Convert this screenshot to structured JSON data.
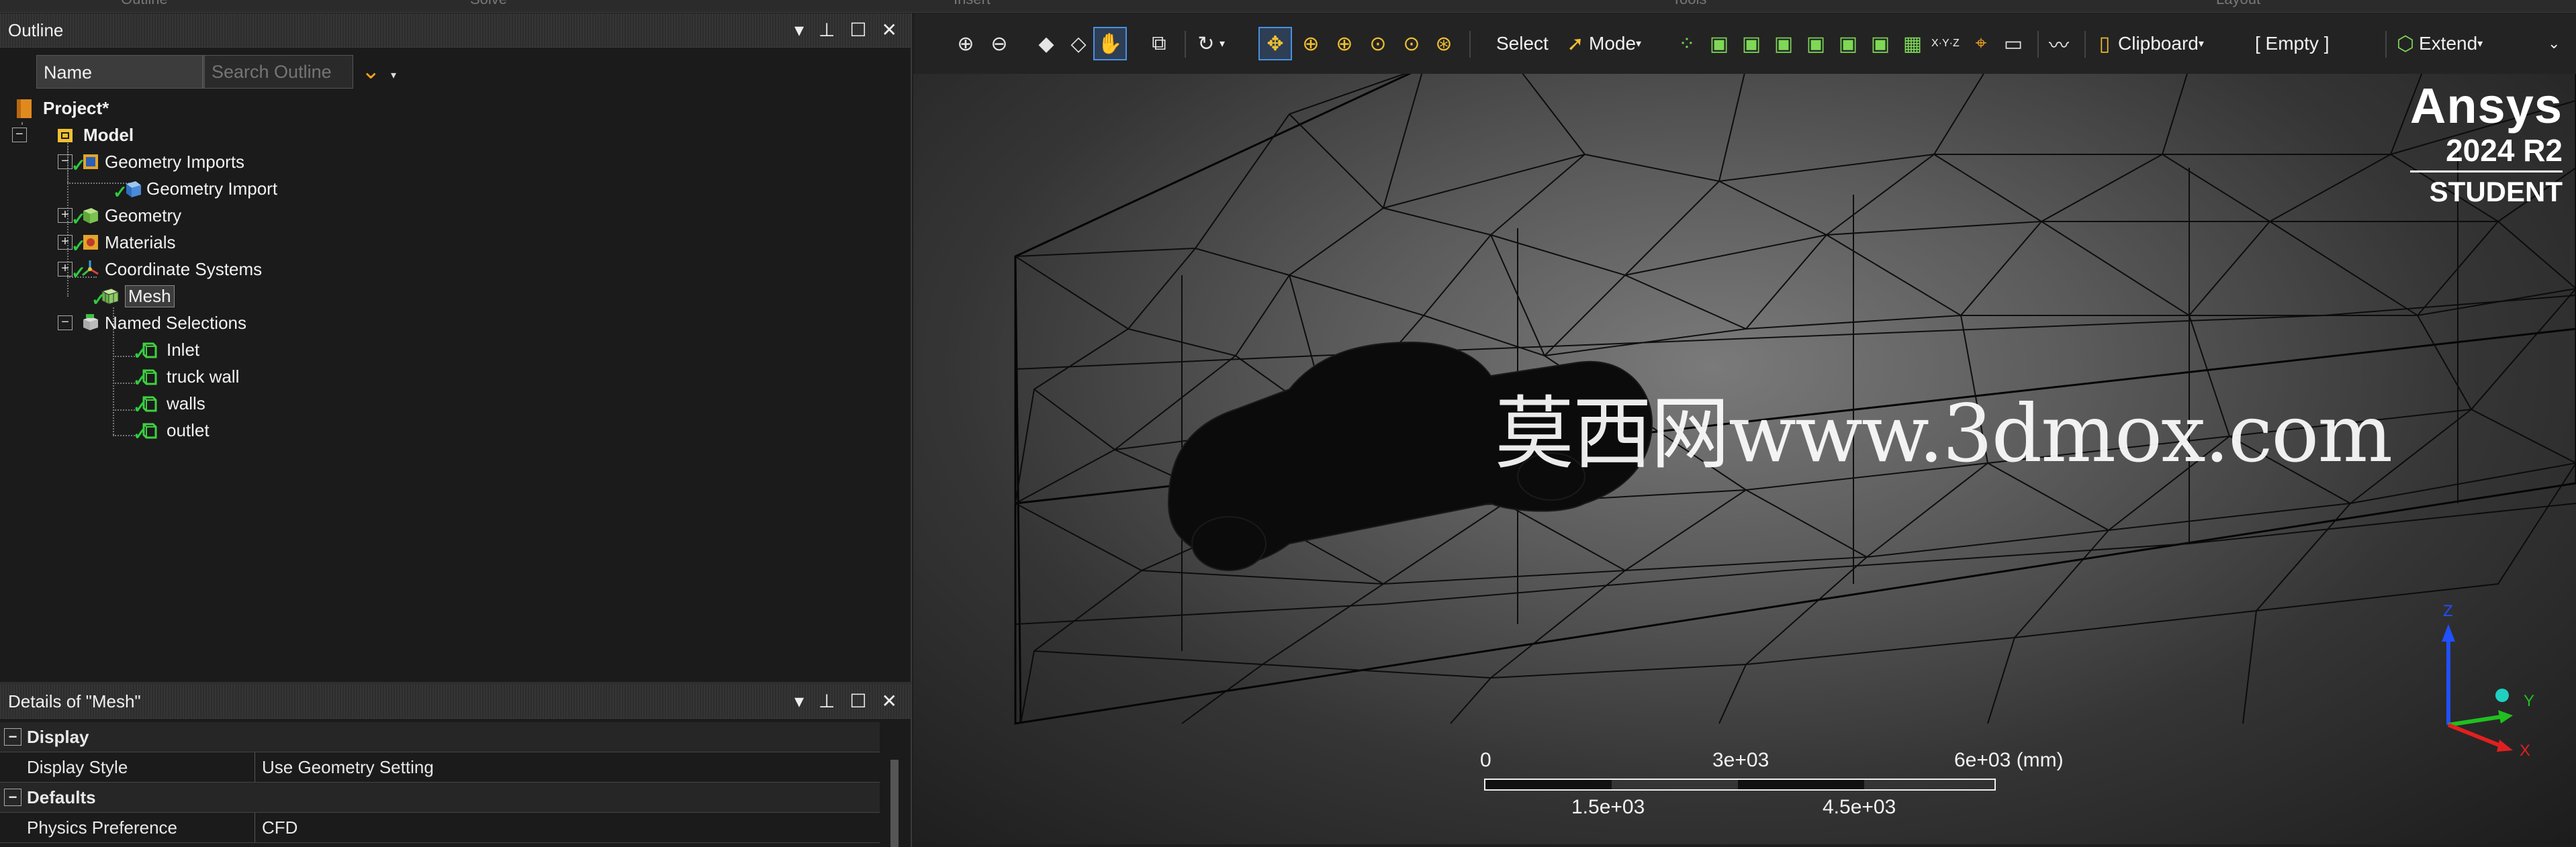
{
  "ribbon_top_tabs": [
    "Outline",
    "Solve",
    "Insert",
    "Tools",
    "Layout"
  ],
  "outline": {
    "title": "Outline",
    "controls": {
      "pin": "▾",
      "dock": "𝗣",
      "max": "☐",
      "close": "✕"
    },
    "filter": {
      "selected": "Name",
      "search_placeholder": "Search Outline"
    },
    "tree": {
      "project": "Project*",
      "model": "Model",
      "geometry_imports": "Geometry Imports",
      "geometry_import": "Geometry Import",
      "geometry": "Geometry",
      "materials": "Materials",
      "coordinate_systems": "Coordinate Systems",
      "mesh": "Mesh",
      "named_selections": "Named Selections",
      "ns_items": [
        "Inlet",
        "truck wall",
        "walls",
        "outlet"
      ]
    }
  },
  "details": {
    "title": "Details of \"Mesh\"",
    "rows": [
      {
        "type": "category",
        "label": "Display"
      },
      {
        "type": "prop",
        "key": "Display Style",
        "value": "Use Geometry Setting"
      },
      {
        "type": "category",
        "label": "Defaults"
      },
      {
        "type": "prop",
        "key": "Physics Preference",
        "value": "CFD"
      }
    ]
  },
  "toolbar": {
    "select_label": "Select",
    "mode_label": "Mode",
    "clipboard_label": "Clipboard",
    "empty_label": "[ Empty ]",
    "extend_label": "Extend",
    "xyz_label": "X·Y·Z"
  },
  "brand": {
    "name": "Ansys",
    "version": "2024 R2",
    "edition": "STUDENT"
  },
  "watermark": "莫西网www.3dmox.com",
  "scale_bar": {
    "top_labels": [
      "0",
      "3e+03",
      "6e+03 (mm)"
    ],
    "bottom_labels": [
      "1.5e+03",
      "4.5e+03"
    ]
  },
  "triad": {
    "x": "X",
    "y": "Y",
    "z": "Z"
  },
  "colors": {
    "accent_check": "#2ecc40",
    "active_tool_border": "#4a90e2",
    "axis_x": "#e02020",
    "axis_y": "#20c020",
    "axis_z": "#2050ff"
  }
}
